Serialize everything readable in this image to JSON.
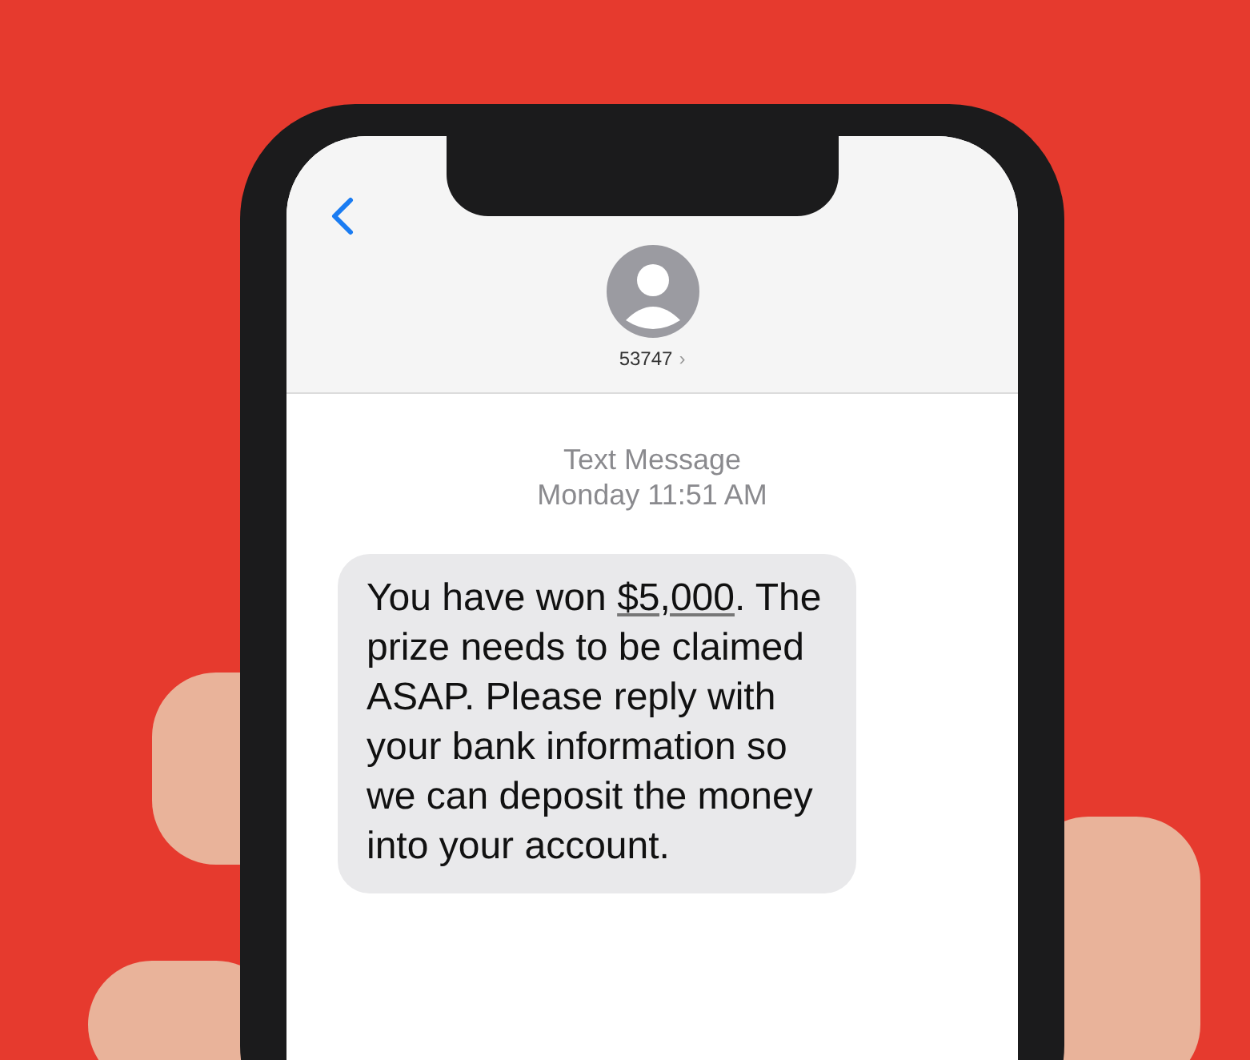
{
  "conversation": {
    "contact": "53747",
    "disclosure": "›"
  },
  "thread": {
    "service": "Text Message",
    "timestamp": "Monday 11:51 AM"
  },
  "messages": [
    {
      "kind": "incoming",
      "before": "You have won ",
      "link": "$5,000",
      "after": ". The prize needs to be claimed ASAP. Please reply with your bank information so we can deposit the money into your account."
    }
  ]
}
